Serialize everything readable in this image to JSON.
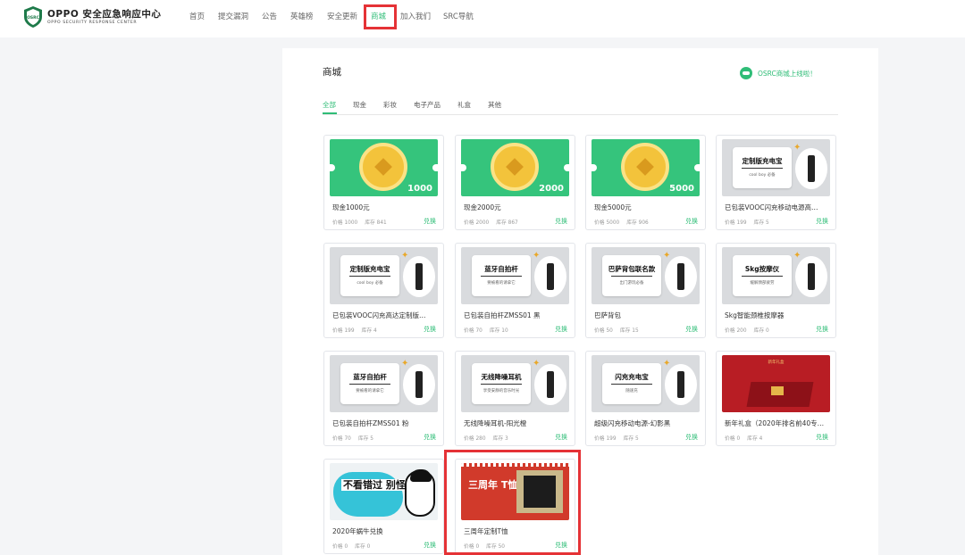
{
  "header": {
    "logo_title": "OPPO 安全应急响应中心",
    "logo_sub": "OPPO SECURITY RESPONSE CENTER",
    "logo_badge": "OSRC",
    "nav": [
      "首页",
      "提交漏洞",
      "公告",
      "英雄榜",
      "安全更新",
      "商城",
      "加入我们",
      "SRC导航"
    ],
    "active_nav": "商城"
  },
  "page": {
    "title": "商城",
    "banner": "OSRC商城上线啦！",
    "tabs": [
      "全部",
      "现金",
      "彩妆",
      "电子产品",
      "礼盒",
      "其他"
    ],
    "active_tab": "全部"
  },
  "labels": {
    "price": "价格",
    "stock": "库存",
    "redeem": "兑换"
  },
  "products": [
    {
      "name": "现金1000元",
      "price": "1000",
      "stock": "841",
      "img": "cash",
      "amount": "1000"
    },
    {
      "name": "现金2000元",
      "price": "2000",
      "stock": "867",
      "img": "cash",
      "amount": "2000"
    },
    {
      "name": "现金5000元",
      "price": "5000",
      "stock": "906",
      "img": "cash",
      "amount": "5000"
    },
    {
      "name": "已包装VOOC闪充移动电源高…",
      "price": "199",
      "stock": "5",
      "img": "prod",
      "caption": "定制版充电宝",
      "sub": "cool boy 必备"
    },
    {
      "name": "已包装VOOC闪充高达定制版…",
      "price": "199",
      "stock": "4",
      "img": "prod",
      "caption": "定制版充电宝",
      "sub": "cool boy 必备"
    },
    {
      "name": "已包装自拍杆ZMSS01 黑",
      "price": "70",
      "stock": "10",
      "img": "prod",
      "caption": "蓝牙自拍杆",
      "sub": "要被看的请拿它"
    },
    {
      "name": "巴萨背包",
      "price": "50",
      "stock": "15",
      "img": "prod",
      "caption": "巴萨背包联名款",
      "sub": "出门游玩必备"
    },
    {
      "name": "Skg智能颈椎按摩器",
      "price": "200",
      "stock": "0",
      "img": "prod",
      "caption": "Skg按摩仪",
      "sub": "缓解颈部疲劳"
    },
    {
      "name": "已包装自拍杆ZMSS01 粉",
      "price": "70",
      "stock": "5",
      "img": "prod",
      "caption": "蓝牙自拍杆",
      "sub": "要被看的请拿它"
    },
    {
      "name": "无线降噪耳机-阳光橙",
      "price": "280",
      "stock": "3",
      "img": "prod",
      "caption": "无线降噪耳机",
      "sub": "享受安静的音乐时光"
    },
    {
      "name": "超级闪充移动电源-幻影黑",
      "price": "199",
      "stock": "5",
      "img": "prod",
      "caption": "闪充充电宝",
      "sub": "随速充"
    },
    {
      "name": "新年礼盒（2020年排名前40专…",
      "price": "0",
      "stock": "4",
      "img": "newyear",
      "caption": "新年礼盒"
    },
    {
      "name": "2020年蜗牛兑换",
      "price": "0",
      "stock": "0",
      "img": "comic",
      "caption": "不看错过 别怪我"
    },
    {
      "name": "三周年定制T恤",
      "price": "0",
      "stock": "50",
      "img": "tee",
      "caption": "三周年 T恤"
    }
  ],
  "colors": {
    "accent": "#2fbd77",
    "highlight": "#e53236"
  }
}
